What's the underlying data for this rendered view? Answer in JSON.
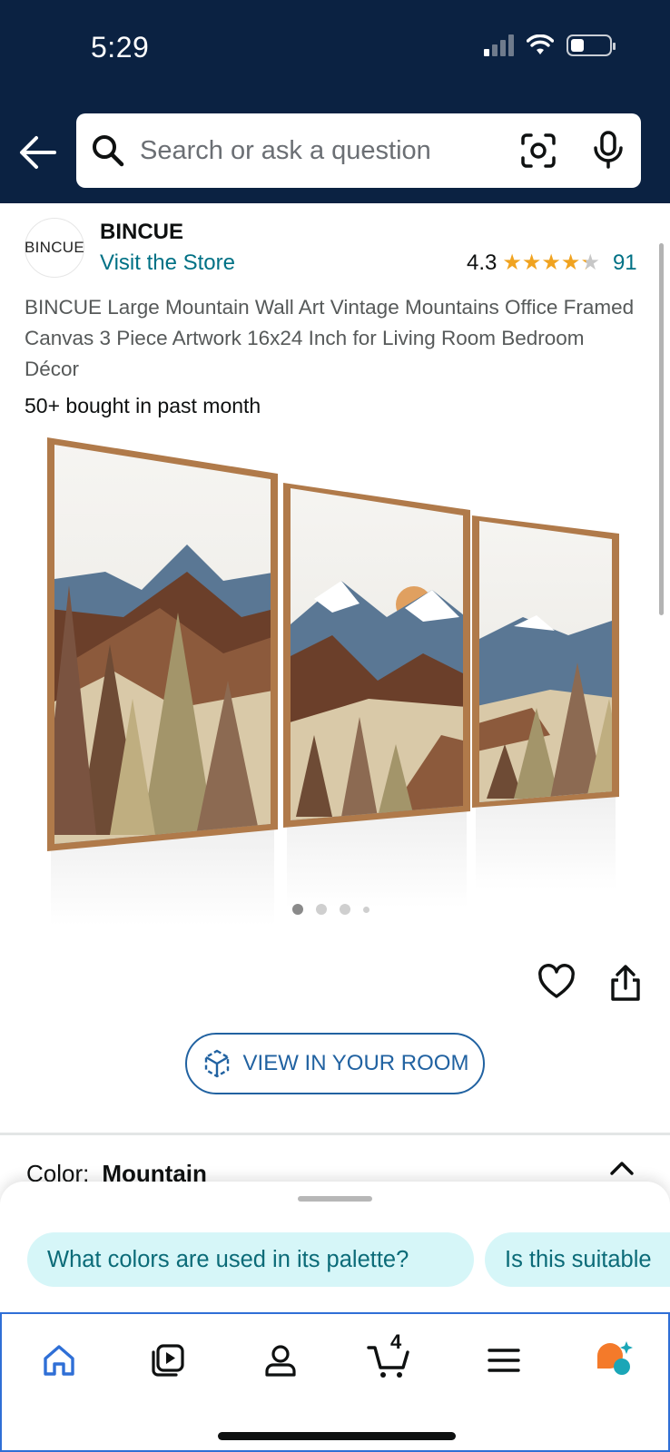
{
  "status_bar": {
    "time": "5:29"
  },
  "header": {
    "search_placeholder": "Search or ask a question",
    "colors": {
      "background": "#0b2242"
    }
  },
  "brand": {
    "logo_text": "BINCUE",
    "name": "BINCUE",
    "visit_store": "Visit the Store",
    "rating": "4.3",
    "stars_out_of_5": 4.3,
    "review_count": "91"
  },
  "product": {
    "title": "BINCUE Large Mountain Wall Art Vintage Mountains Office Framed Canvas 3 Piece Artwork 16x24 Inch for Living Room Bedroom Décor",
    "bought": "50+ bought in past month",
    "image_icon": "mountain-triptych-image",
    "carousel_total": 4,
    "carousel_active": 1
  },
  "actions": {
    "view_in_room": "VIEW IN YOUR ROOM"
  },
  "color": {
    "label": "Color:",
    "value": "Mountain"
  },
  "suggestions": [
    "What colors are used in its palette?",
    "Is this suitable"
  ],
  "bottom_nav": {
    "items": [
      "home-icon",
      "video-icon",
      "account-icon",
      "cart-icon",
      "menu-icon",
      "rufus-icon"
    ],
    "cart_count": "4"
  }
}
